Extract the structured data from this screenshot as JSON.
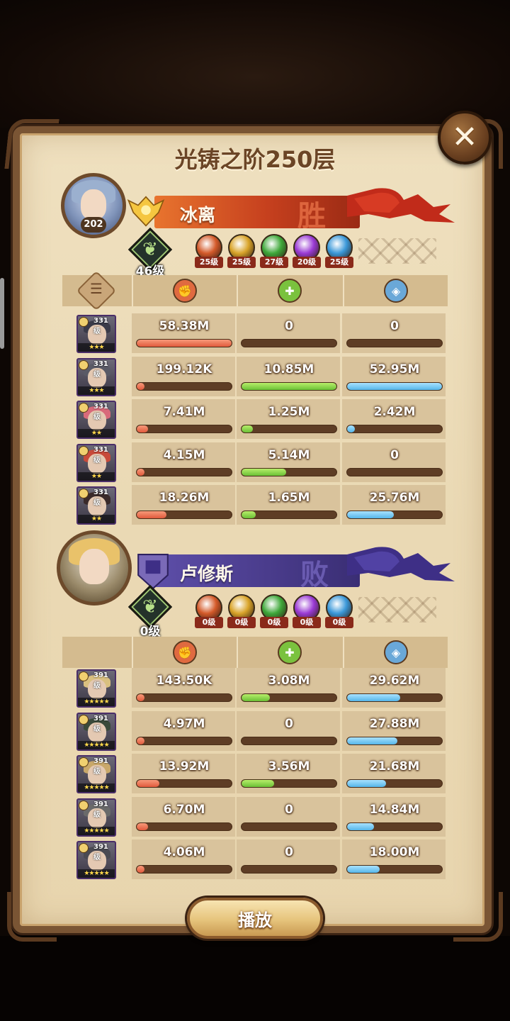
{
  "title": "光铸之阶250层",
  "close_label": "✕",
  "play_label": "播放",
  "winner": {
    "name": "冰离",
    "result": "胜",
    "avatar_level": "202",
    "rank_label": "46级",
    "banner_color": "#b3331c",
    "factions": [
      {
        "icon": "lightbearer-icon",
        "level": "25级",
        "color": "#d45a2a"
      },
      {
        "icon": "mauler-icon",
        "level": "25级",
        "color": "#d9a42a"
      },
      {
        "icon": "wilder-icon",
        "level": "27级",
        "color": "#3fa83a"
      },
      {
        "icon": "graveborn-icon",
        "level": "20级",
        "color": "#9a3ad4"
      },
      {
        "icon": "celestial-icon",
        "level": "25级",
        "color": "#3a98d9"
      }
    ],
    "heroes": [
      {
        "level": "331级",
        "stars": "★★★",
        "damage": "58.38M",
        "heal": "0",
        "shield": "0",
        "damage_pct": 100,
        "heal_pct": 0,
        "shield_pct": 0
      },
      {
        "level": "331级",
        "stars": "★★★",
        "damage": "199.12K",
        "heal": "10.85M",
        "shield": "52.95M",
        "damage_pct": 0.4,
        "heal_pct": 100,
        "shield_pct": 100
      },
      {
        "level": "331级",
        "stars": "★★",
        "damage": "7.41M",
        "heal": "1.25M",
        "shield": "2.42M",
        "damage_pct": 12,
        "heal_pct": 12,
        "shield_pct": 5
      },
      {
        "level": "331级",
        "stars": "★★",
        "damage": "4.15M",
        "heal": "5.14M",
        "shield": "0",
        "damage_pct": 7,
        "heal_pct": 47,
        "shield_pct": 0
      },
      {
        "level": "331级",
        "stars": "★★",
        "damage": "18.26M",
        "heal": "1.65M",
        "shield": "25.76M",
        "damage_pct": 31,
        "heal_pct": 15,
        "shield_pct": 49
      }
    ]
  },
  "loser": {
    "name": "卢修斯",
    "result": "败",
    "rank_label": "0级",
    "banner_color": "#4a3c8c",
    "factions": [
      {
        "icon": "lightbearer-icon",
        "level": "0级",
        "color": "#d45a2a"
      },
      {
        "icon": "mauler-icon",
        "level": "0级",
        "color": "#d9a42a"
      },
      {
        "icon": "wilder-icon",
        "level": "0级",
        "color": "#3fa83a"
      },
      {
        "icon": "graveborn-icon",
        "level": "0级",
        "color": "#9a3ad4"
      },
      {
        "icon": "celestial-icon",
        "level": "0级",
        "color": "#3a98d9"
      }
    ],
    "heroes": [
      {
        "level": "391级",
        "stars": "★★★★★",
        "damage": "143.50K",
        "heal": "3.08M",
        "shield": "29.62M",
        "damage_pct": 1,
        "heal_pct": 30,
        "shield_pct": 56
      },
      {
        "level": "391级",
        "stars": "★★★★★",
        "damage": "4.97M",
        "heal": "0",
        "shield": "27.88M",
        "damage_pct": 8,
        "heal_pct": 0,
        "shield_pct": 53
      },
      {
        "level": "391级",
        "stars": "★★★★★",
        "damage": "13.92M",
        "heal": "3.56M",
        "shield": "21.68M",
        "damage_pct": 24,
        "heal_pct": 34,
        "shield_pct": 41
      },
      {
        "level": "391级",
        "stars": "★★★★★",
        "damage": "6.70M",
        "heal": "0",
        "shield": "14.84M",
        "damage_pct": 12,
        "heal_pct": 0,
        "shield_pct": 28
      },
      {
        "level": "391级",
        "stars": "★★★★★",
        "damage": "4.06M",
        "heal": "0",
        "shield": "18.00M",
        "damage_pct": 7,
        "heal_pct": 0,
        "shield_pct": 34
      }
    ]
  },
  "stat_icons": {
    "damage": "damage-icon",
    "heal": "heal-icon",
    "shield": "shield-icon",
    "detail": "detail-icon"
  }
}
